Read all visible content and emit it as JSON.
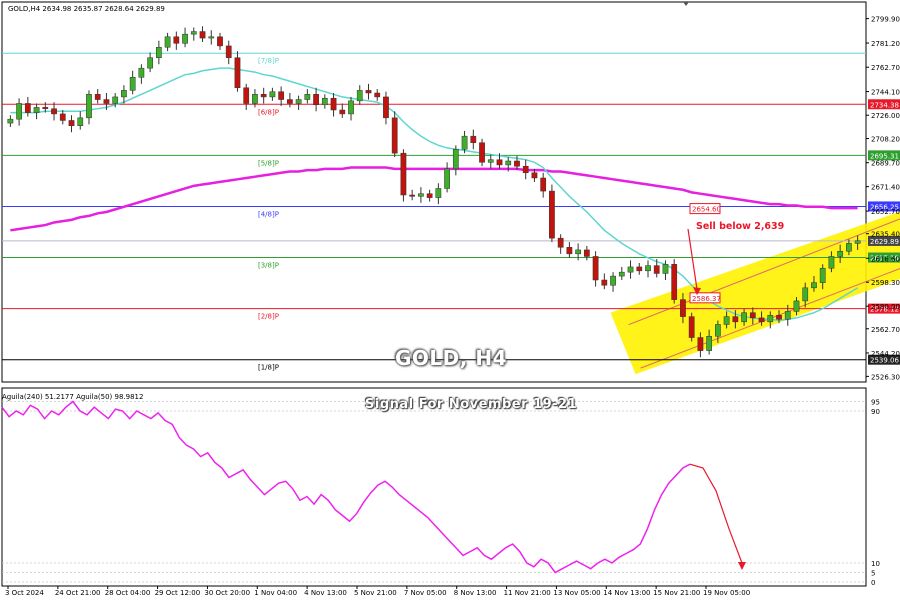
{
  "header": {
    "symbol": "GOLD,H4",
    "ohlc": "2634.98 2635.87 2628.64 2629.89"
  },
  "overlay": {
    "title": "GOLD, H4",
    "subtitle": "Signal For November 19-21",
    "sell_text": "Sell below 2,639"
  },
  "colors": {
    "bull_candle": "#3fae2a",
    "bear_candle": "#c0140c",
    "ma_fast": "#5ed6d0",
    "ma_slow": "#e61fe0",
    "oscillator": "#ee22ee",
    "channel": "#fff200",
    "arrow": "#e8182a"
  },
  "chart_data": [
    {
      "type": "candlestick",
      "ylim": [
        2522,
        2808
      ],
      "y_ticks": [
        2799.9,
        2781.2,
        2762.7,
        2744.1,
        2726.0,
        2708.2,
        2689.7,
        2671.4,
        2652.7,
        2635.4,
        2616.6,
        2598.3,
        2580.0,
        2562.7,
        2544.2,
        2526.3
      ],
      "x_labels": [
        "3 Oct 2024",
        "24 Oct 21:00",
        "28 Oct 04:00",
        "29 Oct 12:00",
        "30 Oct 20:00",
        "1 Nov 04:00",
        "4 Nov 13:00",
        "5 Nov 21:00",
        "7 Nov 05:00",
        "8 Nov 13:00",
        "11 Nov 21:00",
        "13 Nov 05:00",
        "14 Nov 13:00",
        "15 Nov 21:00",
        "19 Nov 05:00"
      ],
      "murrey_levels": [
        {
          "label": "[6/8]P",
          "price": 2734.38,
          "price_label": "2734.38",
          "color": "#e8182a"
        },
        {
          "label": "[5/8]P",
          "price": 2695.31,
          "price_label": "2695.31",
          "color": "#2e9e2e"
        },
        {
          "label": "[4/8]P",
          "price": 2656.25,
          "price_label": "2656.25",
          "color": "#3a3aff"
        },
        {
          "label": "[3/8]P",
          "price": 2617.19,
          "price_label": "2617.19",
          "color": "#2e9e2e"
        },
        {
          "label": "[2/8]P",
          "price": 2578.12,
          "price_label": "2578.12",
          "color": "#e8182a"
        },
        {
          "label": "[1/8]P",
          "price": 2539.06,
          "price_label": "2539.06",
          "color": "#000000"
        },
        {
          "label": "[7/8]P",
          "price": 2773.44,
          "price_label": "",
          "color": "#5ed6d0"
        }
      ],
      "current_price": {
        "price": 2629.89,
        "label": "2629.89"
      },
      "price_boxes": [
        {
          "price": 2654.6,
          "label": "2654.60"
        },
        {
          "price": 2586.37,
          "label": "2586.37"
        }
      ],
      "close": [
        2723,
        2735,
        2728,
        2732,
        2731,
        2727,
        2722,
        2718,
        2724,
        2742,
        2738,
        2735,
        2740,
        2745,
        2755,
        2762,
        2770,
        2778,
        2786,
        2781,
        2788,
        2790,
        2785,
        2786,
        2779,
        2770,
        2747,
        2735,
        2742,
        2740,
        2744,
        2738,
        2735,
        2738,
        2742,
        2734,
        2739,
        2730,
        2727,
        2737,
        2745,
        2743,
        2740,
        2724,
        2697,
        2665,
        2664,
        2666,
        2663,
        2670,
        2685,
        2700,
        2710,
        2705,
        2690,
        2692,
        2688,
        2691,
        2687,
        2682,
        2678,
        2668,
        2632,
        2625,
        2620,
        2623,
        2618,
        2600,
        2596,
        2603,
        2606,
        2610,
        2607,
        2611,
        2605,
        2612,
        2585,
        2572,
        2556,
        2546,
        2557,
        2566,
        2572,
        2568,
        2575,
        2571,
        2568,
        2573,
        2570,
        2576,
        2584,
        2594,
        2598,
        2609,
        2618,
        2622,
        2628,
        2630
      ],
      "ma_fast": [
        2728,
        2728,
        2728,
        2728,
        2729,
        2729,
        2729,
        2729,
        2729,
        2730,
        2731,
        2732,
        2734,
        2736,
        2739,
        2742,
        2745,
        2748,
        2751,
        2754,
        2757,
        2758,
        2760,
        2761,
        2762,
        2762,
        2761,
        2760,
        2759,
        2757,
        2756,
        2754,
        2752,
        2750,
        2748,
        2746,
        2744,
        2742,
        2740,
        2739,
        2738,
        2737,
        2736,
        2733,
        2728,
        2721,
        2715,
        2710,
        2706,
        2703,
        2701,
        2700,
        2699,
        2698,
        2697,
        2696,
        2695,
        2694,
        2693,
        2692,
        2690,
        2686,
        2678,
        2671,
        2664,
        2658,
        2652,
        2645,
        2638,
        2633,
        2628,
        2624,
        2620,
        2617,
        2614,
        2612,
        2608,
        2603,
        2596,
        2589,
        2584,
        2580,
        2577,
        2574,
        2572,
        2571,
        2570,
        2570,
        2569,
        2570,
        2571,
        2573,
        2575,
        2578,
        2582,
        2586,
        2590,
        2594
      ],
      "ma_slow": [
        2638,
        2639,
        2640,
        2641,
        2642,
        2644,
        2645,
        2646,
        2648,
        2649,
        2651,
        2652,
        2654,
        2656,
        2658,
        2660,
        2662,
        2664,
        2666,
        2668,
        2670,
        2672,
        2673,
        2674,
        2675,
        2676,
        2677,
        2678,
        2679,
        2680,
        2681,
        2682,
        2683,
        2683,
        2684,
        2684,
        2685,
        2685,
        2685,
        2686,
        2686,
        2686,
        2686,
        2686,
        2685,
        2685,
        2685,
        2685,
        2685,
        2685,
        2685,
        2685,
        2685,
        2685,
        2685,
        2685,
        2685,
        2685,
        2685,
        2684,
        2684,
        2684,
        2683,
        2683,
        2682,
        2681,
        2680,
        2679,
        2678,
        2677,
        2676,
        2675,
        2674,
        2673,
        2672,
        2671,
        2670,
        2669,
        2667,
        2666,
        2665,
        2664,
        2663,
        2662,
        2661,
        2660,
        2659,
        2658,
        2658,
        2657,
        2657,
        2656,
        2656,
        2656,
        2655,
        2655,
        2655,
        2655
      ],
      "sell_zone": {
        "label": "Sell below 2,639",
        "level": 2639
      },
      "channel": {
        "upper": [
          2575,
          2660
        ],
        "lower": [
          2528,
          2625
        ],
        "x_range": [
          71,
          96
        ]
      }
    },
    {
      "type": "line",
      "title": "Aguila(240) 51.2177  Aguila(50) 98.9812",
      "ylim": [
        0,
        100
      ],
      "y_ticks": [
        95,
        90,
        10,
        5,
        0
      ],
      "series": [
        {
          "values": [
            92,
            87,
            90,
            88,
            93,
            91,
            86,
            90,
            88,
            92,
            95,
            90,
            88,
            92,
            89,
            86,
            91,
            90,
            86,
            90,
            88,
            86,
            89,
            85,
            83,
            76,
            72,
            70,
            66,
            68,
            63,
            60,
            55,
            57,
            59,
            54,
            50,
            46,
            49,
            52,
            53,
            49,
            43,
            45,
            41,
            46,
            43,
            38,
            35,
            32,
            36,
            42,
            47,
            51,
            53,
            50,
            46,
            43,
            40,
            37,
            34,
            30,
            26,
            22,
            18,
            14,
            16,
            18,
            14,
            12,
            15,
            18,
            20,
            16,
            10,
            8,
            12,
            10,
            5,
            7,
            9,
            11,
            9,
            7,
            10,
            12,
            10,
            13,
            15,
            17,
            20,
            28,
            38,
            46,
            52,
            56,
            60,
            62
          ]
        }
      ],
      "forecast": [
        62,
        60,
        48,
        28,
        10
      ]
    }
  ]
}
